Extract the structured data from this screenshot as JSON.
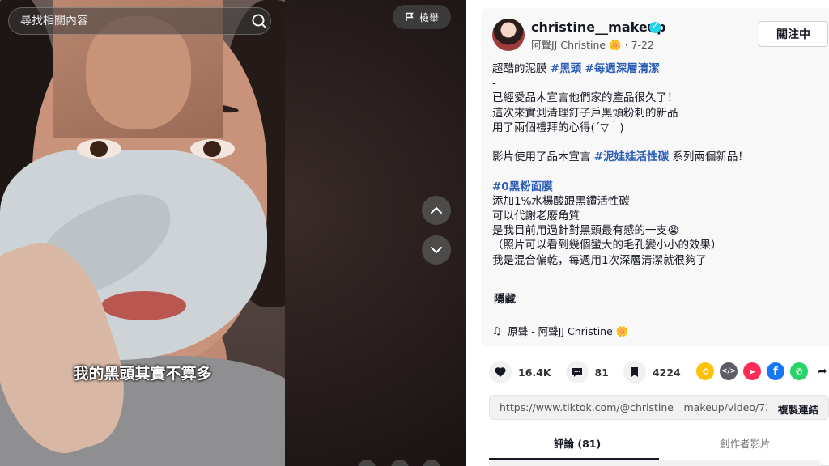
{
  "search": {
    "placeholder": "尋找相關內容"
  },
  "video": {
    "report_label": "檢舉",
    "caption": "我的黑頭其實不算多"
  },
  "author": {
    "username": "christine__makeup",
    "nickname": "阿聲JJ Christine 🌼",
    "date": "7-22",
    "follow_label": "關注中"
  },
  "description": {
    "line1_text": "超酷的泥膜 ",
    "line1_tag1": "#黑頭",
    "line1_tag2": "#每週深層清潔",
    "line2": "-",
    "line3": "已經愛品木宣言他們家的產品很久了！",
    "line4": "這次來實測清理釘子戶黑頭粉刺的新品",
    "line5": "用了兩個禮拜的心得(´▽｀)",
    "line7_text": "影片使用了品木宣言 ",
    "line7_tag": "#泥娃娃活性碳",
    "line7_suffix": " 系列兩個新品！",
    "line9_tag": "#0黑粉面膜",
    "line10": "添加1%水楊酸跟黑鑽活性碳",
    "line11": "可以代謝老廢角質",
    "line12": "是我目前用過針對黑頭最有感的一支😭",
    "line13": "（照片可以看到幾個蠻大的毛孔變小小的效果）",
    "line14": "我是混合偏乾，每週用1次深層清潔就很夠了",
    "hide_label": "隱藏"
  },
  "music": {
    "label": "原聲 - 阿聲JJ Christine 🌼"
  },
  "stats": {
    "likes": "16.4K",
    "comments": "81",
    "saves": "4224"
  },
  "share_icons": [
    "repost-icon",
    "embed-icon",
    "send-icon",
    "facebook-icon",
    "whatsapp-icon",
    "share-arrow-icon"
  ],
  "link": {
    "url": "https://www.tiktok.com/@christine__makeup/video/739...",
    "copy_label": "複製連結"
  },
  "tabs": {
    "comments": "評論 (81)",
    "creator_videos": "創作者影片"
  },
  "colors": {
    "accent_link": "#2b5db9",
    "verified": "#20d5ec",
    "facebook": "#1877f2",
    "whatsapp": "#25d366",
    "send": "#fe2c55",
    "repost": "#ffc107"
  }
}
